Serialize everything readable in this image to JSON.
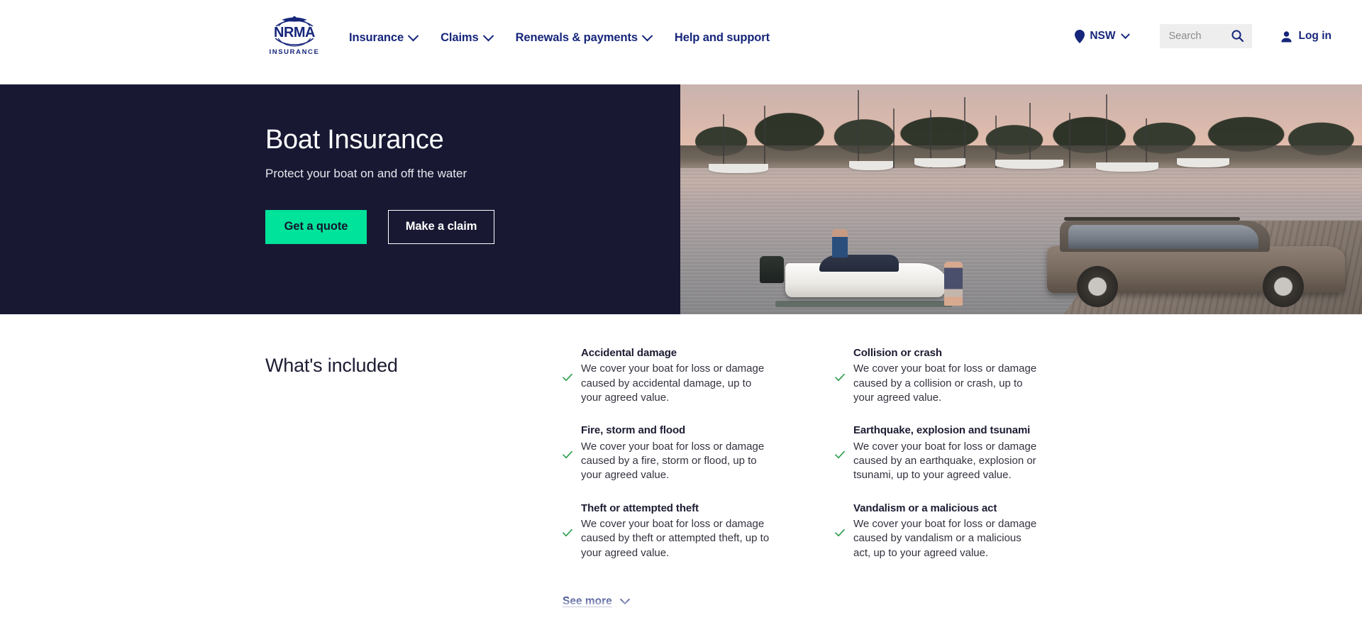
{
  "header": {
    "logo": {
      "name": "NRMA",
      "sub": "INSURANCE"
    },
    "nav": [
      {
        "label": "Insurance",
        "has_dropdown": true
      },
      {
        "label": "Claims",
        "has_dropdown": true
      },
      {
        "label": "Renewals & payments",
        "has_dropdown": true
      },
      {
        "label": "Help and support",
        "has_dropdown": false
      }
    ],
    "location": {
      "label": "NSW",
      "icon": "location-pin-icon"
    },
    "search": {
      "placeholder": "Search",
      "value": "",
      "icon": "search-icon"
    },
    "account": {
      "label": "Log in",
      "icon": "user-icon"
    }
  },
  "hero": {
    "title": "Boat Insurance",
    "subtitle": "Protect your boat on and off the water",
    "primary_cta": "Get a quote",
    "secondary_cta": "Make a claim",
    "background_color": "#181833",
    "primary_cta_color": "#00e39a",
    "image_alt": "Boat on a trailer being launched at a marina boat ramp at sunset with an SUV"
  },
  "included": {
    "title": "What's included",
    "tick_color": "#2e9e4f",
    "columns": [
      {
        "features": [
          {
            "title": "Accidental damage",
            "description": "We cover your boat for loss or damage caused by accidental damage, up to your agreed value."
          },
          {
            "title": "Fire, storm and flood",
            "description": "We cover your boat for loss or damage caused by a fire, storm or flood, up to your agreed value."
          },
          {
            "title": "Theft or attempted theft",
            "description": "We cover your boat for loss or damage caused by theft or attempted theft, up to your agreed value."
          }
        ]
      },
      {
        "features": [
          {
            "title": "Collision or crash",
            "description": "We cover your boat for loss or damage caused by a collision or crash, up to your agreed value."
          },
          {
            "title": "Earthquake, explosion and tsunami",
            "description": "We cover your boat for loss or damage caused by an earthquake, explosion or tsunami, up to your agreed value."
          },
          {
            "title": "Vandalism or a malicious act",
            "description": "We cover your boat for loss or damage caused by vandalism or a malicious act, up to your agreed value."
          }
        ]
      }
    ],
    "see_more": {
      "label": "See more",
      "icon": "chevron-down-icon"
    }
  }
}
